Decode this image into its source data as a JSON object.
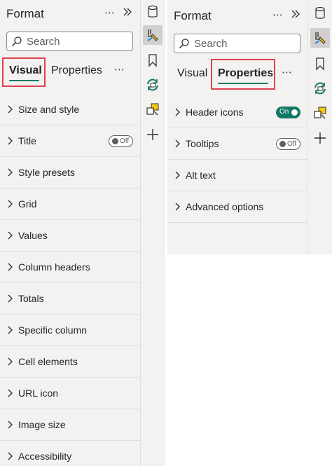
{
  "left_pane": {
    "title": "Format",
    "more_glyph": "⋯",
    "collapse_glyph": "»",
    "search_placeholder": "Search",
    "tabs": [
      {
        "label": "Visual",
        "active": true
      },
      {
        "label": "Properties",
        "active": false
      }
    ],
    "tabs_more_glyph": "⋯",
    "cards": [
      {
        "label": "Size and style"
      },
      {
        "label": "Title",
        "toggle": "Off"
      },
      {
        "label": "Style presets"
      },
      {
        "label": "Grid"
      },
      {
        "label": "Values"
      },
      {
        "label": "Column headers"
      },
      {
        "label": "Totals"
      },
      {
        "label": "Specific column"
      },
      {
        "label": "Cell elements"
      },
      {
        "label": "URL icon"
      },
      {
        "label": "Image size"
      },
      {
        "label": "Accessibility"
      }
    ]
  },
  "right_pane": {
    "title": "Format",
    "more_glyph": "⋯",
    "collapse_glyph": "»",
    "search_placeholder": "Search",
    "tabs": [
      {
        "label": "Visual",
        "active": false
      },
      {
        "label": "Properties",
        "active": true
      }
    ],
    "tabs_more_glyph": "⋯",
    "cards": [
      {
        "label": "Header icons",
        "toggle": "On"
      },
      {
        "label": "Tooltips",
        "toggle": "Off"
      },
      {
        "label": "Alt text"
      },
      {
        "label": "Advanced options"
      }
    ]
  },
  "rail_icons": [
    "database-icon",
    "format-paint-icon",
    "bookmark-icon",
    "sync-icon",
    "drillthrough-icon",
    "add-icon"
  ],
  "colors": {
    "accent": "#117865",
    "highlight": "#e0424a",
    "pane_bg": "#f3f2f1"
  }
}
